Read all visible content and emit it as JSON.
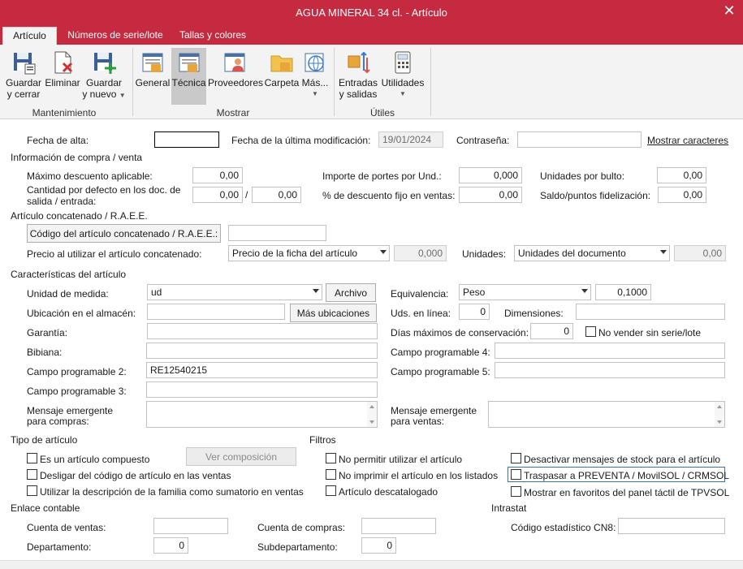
{
  "window": {
    "title": "AGUA MINERAL 34 cl. - Artículo",
    "close": "✕"
  },
  "tabs": [
    "Artículo",
    "Números de serie/lote",
    "Tallas y colores"
  ],
  "ribbon": {
    "buttons": [
      {
        "label1": "Guardar",
        "label2": "y cerrar",
        "icon": "save-close-icon"
      },
      {
        "label1": "Eliminar",
        "label2": "",
        "icon": "delete-icon"
      },
      {
        "label1": "Guardar",
        "label2": "y nuevo",
        "icon": "save-new-icon"
      },
      {
        "label1": "General",
        "label2": "",
        "icon": "general-icon"
      },
      {
        "label1": "Técnica",
        "label2": "",
        "icon": "technical-icon"
      },
      {
        "label1": "Proveedores",
        "label2": "",
        "icon": "suppliers-icon"
      },
      {
        "label1": "Carpeta",
        "label2": "",
        "icon": "folder-icon"
      },
      {
        "label1": "Más...",
        "label2": "",
        "icon": "more-icon"
      },
      {
        "label1": "Entradas",
        "label2": "y salidas",
        "icon": "in-out-icon"
      },
      {
        "label1": "Utilidades",
        "label2": "",
        "icon": "utilities-icon"
      }
    ],
    "groups": [
      "Mantenimiento",
      "Mostrar",
      "Útiles"
    ]
  },
  "form": {
    "fecha_alta_label": "Fecha de alta:",
    "fecha_alta_value": "",
    "fecha_mod_label": "Fecha de la última modificación:",
    "fecha_mod_value": "19/01/2024",
    "contrasena_label": "Contraseña:",
    "contrasena_value": "",
    "mostrar_caracteres": "Mostrar caracteres",
    "compra_venta_title": "Información de compra / venta",
    "max_descuento_label": "Máximo descuento aplicable:",
    "max_descuento_value": "0,00",
    "cantidad_defecto_label1": "Cantidad por defecto en los doc. de",
    "cantidad_defecto_label2": "salida / entrada:",
    "cantidad_salida": "0,00",
    "slash": "/",
    "cantidad_entrada": "0,00",
    "importe_portes_label": "Importe de portes por Und.:",
    "importe_portes_value": "0,000",
    "desc_fijo_label": "% de descuento fijo en ventas:",
    "desc_fijo_value": "0,00",
    "unidades_bulto_label": "Unidades por bulto:",
    "unidades_bulto_value": "0,00",
    "saldo_puntos_label": "Saldo/puntos fidelización:",
    "saldo_puntos_value": "0,00",
    "concatenado_title": "Artículo concatenado / R.A.E.E.",
    "codigo_concat_button": "Código del artículo concatenado / R.A.E.E.:",
    "codigo_concat_value": "",
    "precio_concat_label": "Precio al utilizar el artículo concatenado:",
    "precio_concat_select": "Precio de la ficha del artículo",
    "precio_concat_value": "0,000",
    "unidades_label": "Unidades:",
    "unidades_select": "Unidades del documento",
    "unidades_value": "0,00",
    "caracteristicas_title": "Características del artículo",
    "unidad_medida_label": "Unidad de medida:",
    "unidad_medida_value": "ud",
    "archivo_button": "Archivo",
    "equivalencia_label": "Equivalencia:",
    "equivalencia_select": "Peso",
    "equivalencia_value": "0,1000",
    "ubicacion_label": "Ubicación en el almacén:",
    "ubicacion_value": "",
    "mas_ubicaciones_button": "Más ubicaciones",
    "uds_linea_label": "Uds. en línea:",
    "uds_linea_value": "0",
    "dimensiones_label": "Dimensiones:",
    "dimensiones_value": "",
    "garantia_label": "Garantía:",
    "garantia_value": "",
    "dias_max_label": "Días máximos de conservación:",
    "dias_max_value": "0",
    "no_vender_label": "No vender sin serie/lote",
    "bibiana_label": "Bibiana:",
    "bibiana_value": "",
    "campo4_label": "Campo programable 4:",
    "campo4_value": "",
    "campo2_label": "Campo programable 2:",
    "campo2_value": "RE12540215",
    "campo5_label": "Campo programable 5:",
    "campo5_value": "",
    "campo3_label": "Campo programable 3:",
    "campo3_value": "",
    "msg_compras_label1": "Mensaje emergente",
    "msg_compras_label2": "para compras:",
    "msg_ventas_label1": "Mensaje emergente",
    "msg_ventas_label2": "para ventas:",
    "tipo_title": "Tipo de artículo",
    "compuesto_label": "Es un artículo compuesto",
    "ver_composicion_button": "Ver composición",
    "desligar_label": "Desligar del código de artículo en las ventas",
    "utilizar_desc_label": "Utilizar la descripción de la familia como sumatorio en ventas",
    "filtros_title": "Filtros",
    "no_permitir_label": "No permitir utilizar el artículo",
    "no_imprimir_label": "No imprimir el artículo en los listados",
    "descatalogado_label": "Artículo descatalogado",
    "desactivar_label": "Desactivar mensajes de stock para el artículo",
    "traspasar_label": "Traspasar a PREVENTA / MovilSOL / CRMSOL",
    "favoritos_label": "Mostrar en favoritos del panel táctil de TPVSOL",
    "enlace_title": "Enlace contable",
    "cuenta_ventas_label": "Cuenta de ventas:",
    "cuenta_ventas_value": "",
    "cuenta_compras_label": "Cuenta de compras:",
    "cuenta_compras_value": "",
    "departamento_label": "Departamento:",
    "departamento_value": "0",
    "subdepartamento_label": "Subdepartamento:",
    "subdepartamento_value": "0",
    "intrastat_title": "Intrastat",
    "cn8_label": "Código estadístico CN8:",
    "cn8_value": ""
  },
  "colors": {
    "titlebar": "#c62a40",
    "ribbon": "#f3f3f3"
  }
}
